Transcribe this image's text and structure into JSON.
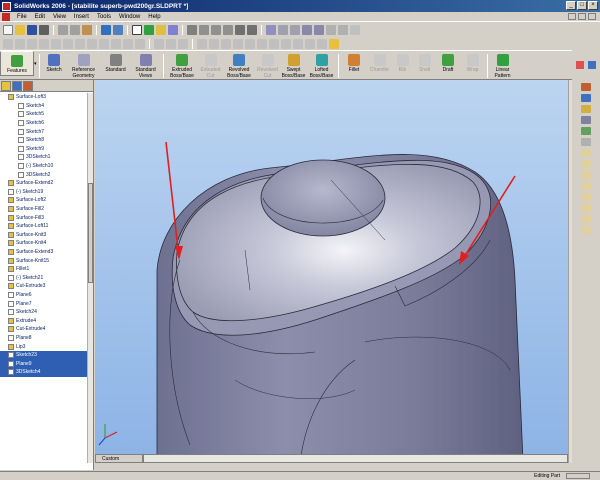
{
  "window": {
    "title": "SolidWorks 2006 - [stabilite superb-pwd200gr.SLDPRT *]"
  },
  "menu": [
    "File",
    "Edit",
    "View",
    "Insert",
    "Tools",
    "Window",
    "Help"
  ],
  "command_manager": {
    "features_label": "Features",
    "items": [
      {
        "label": "Sketch",
        "disabled": false
      },
      {
        "label": "Reference Geometry",
        "disabled": false
      },
      {
        "label": "Standard",
        "disabled": false
      },
      {
        "label": "Standard Views",
        "disabled": false
      },
      {
        "label": "Extruded Boss/Base",
        "disabled": false
      },
      {
        "label": "Extruded Cut",
        "disabled": true
      },
      {
        "label": "Revolved Boss/Base",
        "disabled": false
      },
      {
        "label": "Revolved Cut",
        "disabled": true
      },
      {
        "label": "Swept Boss/Base",
        "disabled": false
      },
      {
        "label": "Lofted Boss/Base",
        "disabled": false
      },
      {
        "label": "Fillet",
        "disabled": false
      },
      {
        "label": "Chamfer",
        "disabled": true
      },
      {
        "label": "Rib",
        "disabled": true
      },
      {
        "label": "Shell",
        "disabled": true
      },
      {
        "label": "Draft",
        "disabled": false
      },
      {
        "label": "Wrap",
        "disabled": true
      },
      {
        "label": "Linear Pattern",
        "disabled": false
      }
    ]
  },
  "tree": {
    "items": [
      {
        "label": "Surface-Loft3",
        "selected": false,
        "indent": 1
      },
      {
        "label": "Sketch4",
        "selected": false,
        "indent": 2
      },
      {
        "label": "Sketch5",
        "selected": false,
        "indent": 2
      },
      {
        "label": "Sketch6",
        "selected": false,
        "indent": 2
      },
      {
        "label": "Sketch7",
        "selected": false,
        "indent": 2
      },
      {
        "label": "Sketch8",
        "selected": false,
        "indent": 2
      },
      {
        "label": "Sketch9",
        "selected": false,
        "indent": 2
      },
      {
        "label": "3DSketch1",
        "selected": false,
        "indent": 2
      },
      {
        "label": "(-) Sketch10",
        "selected": false,
        "indent": 2
      },
      {
        "label": "3DSketch2",
        "selected": false,
        "indent": 2
      },
      {
        "label": "Surface-Extend2",
        "selected": false,
        "indent": 1
      },
      {
        "label": "(-) Sketch19",
        "selected": false,
        "indent": 1
      },
      {
        "label": "Surface-Loft2",
        "selected": false,
        "indent": 1
      },
      {
        "label": "Surface-Fill2",
        "selected": false,
        "indent": 1
      },
      {
        "label": "Surface-Fill3",
        "selected": false,
        "indent": 1
      },
      {
        "label": "Surface-Loft11",
        "selected": false,
        "indent": 1
      },
      {
        "label": "Surface-Knit3",
        "selected": false,
        "indent": 1
      },
      {
        "label": "Surface-Knit4",
        "selected": false,
        "indent": 1
      },
      {
        "label": "Surface-Extend3",
        "selected": false,
        "indent": 1
      },
      {
        "label": "Surface-Knit15",
        "selected": false,
        "indent": 1
      },
      {
        "label": "Fillet1",
        "selected": false,
        "indent": 1
      },
      {
        "label": "(-) Sketch21",
        "selected": false,
        "indent": 1
      },
      {
        "label": "Cut-Extrude3",
        "selected": false,
        "indent": 1
      },
      {
        "label": "Plane6",
        "selected": false,
        "indent": 1
      },
      {
        "label": "Plane7",
        "selected": false,
        "indent": 1
      },
      {
        "label": "Sketch24",
        "selected": false,
        "indent": 1
      },
      {
        "label": "Extrude4",
        "selected": false,
        "indent": 1
      },
      {
        "label": "Cut-Extrude4",
        "selected": false,
        "indent": 1
      },
      {
        "label": "Plane8",
        "selected": false,
        "indent": 1
      },
      {
        "label": "Lip3",
        "selected": false,
        "indent": 1
      },
      {
        "label": "Sketch23",
        "selected": true,
        "indent": 1
      },
      {
        "label": "Plane9",
        "selected": true,
        "indent": 1
      },
      {
        "label": "3DSketch4",
        "selected": true,
        "indent": 1
      }
    ]
  },
  "viewport": {
    "tab_label": "Custom"
  },
  "status": {
    "text": "Editing Part"
  },
  "colors": {
    "selection": "#2f5fb3",
    "annotation_arrow": "#e02020",
    "model_body": "#8a8ca8",
    "model_top": "#c8cadb"
  }
}
